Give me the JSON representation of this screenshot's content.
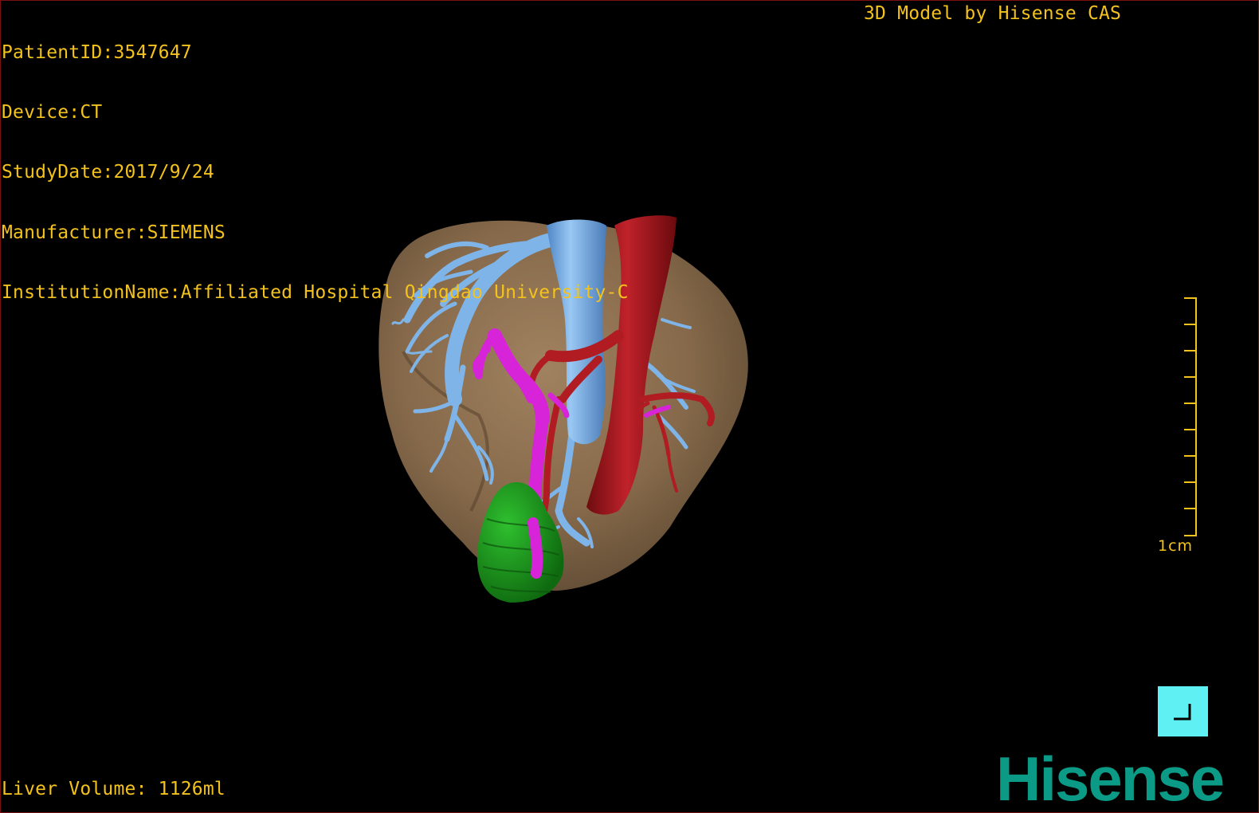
{
  "info": {
    "patient_id": "PatientID:3547647",
    "device": "Device:CT",
    "study_date": "StudyDate:2017/9/24",
    "manufacturer": "Manufacturer:SIEMENS",
    "institution": "InstitutionName:Affiliated Hospital Qingdao University-C"
  },
  "brand_label": "3D Model by Hisense CAS",
  "liver_volume": "Liver Volume: 1126ml",
  "scale": {
    "label": "1cm"
  },
  "logo": {
    "text": "Hisense",
    "color": "#0a9a86"
  },
  "colors": {
    "overlay_text": "#f3c21d",
    "liver": "#8a6e4c",
    "hepatic_vein": "#7fb4e8",
    "portal_vein": "#a3141c",
    "bile_duct": "#d824d8",
    "tumor": "#1f9a1f",
    "corner_button": "#5ff0f4"
  },
  "model": {
    "structures": [
      "liver",
      "hepatic-vein",
      "portal-vein",
      "bile-duct",
      "tumor"
    ]
  }
}
